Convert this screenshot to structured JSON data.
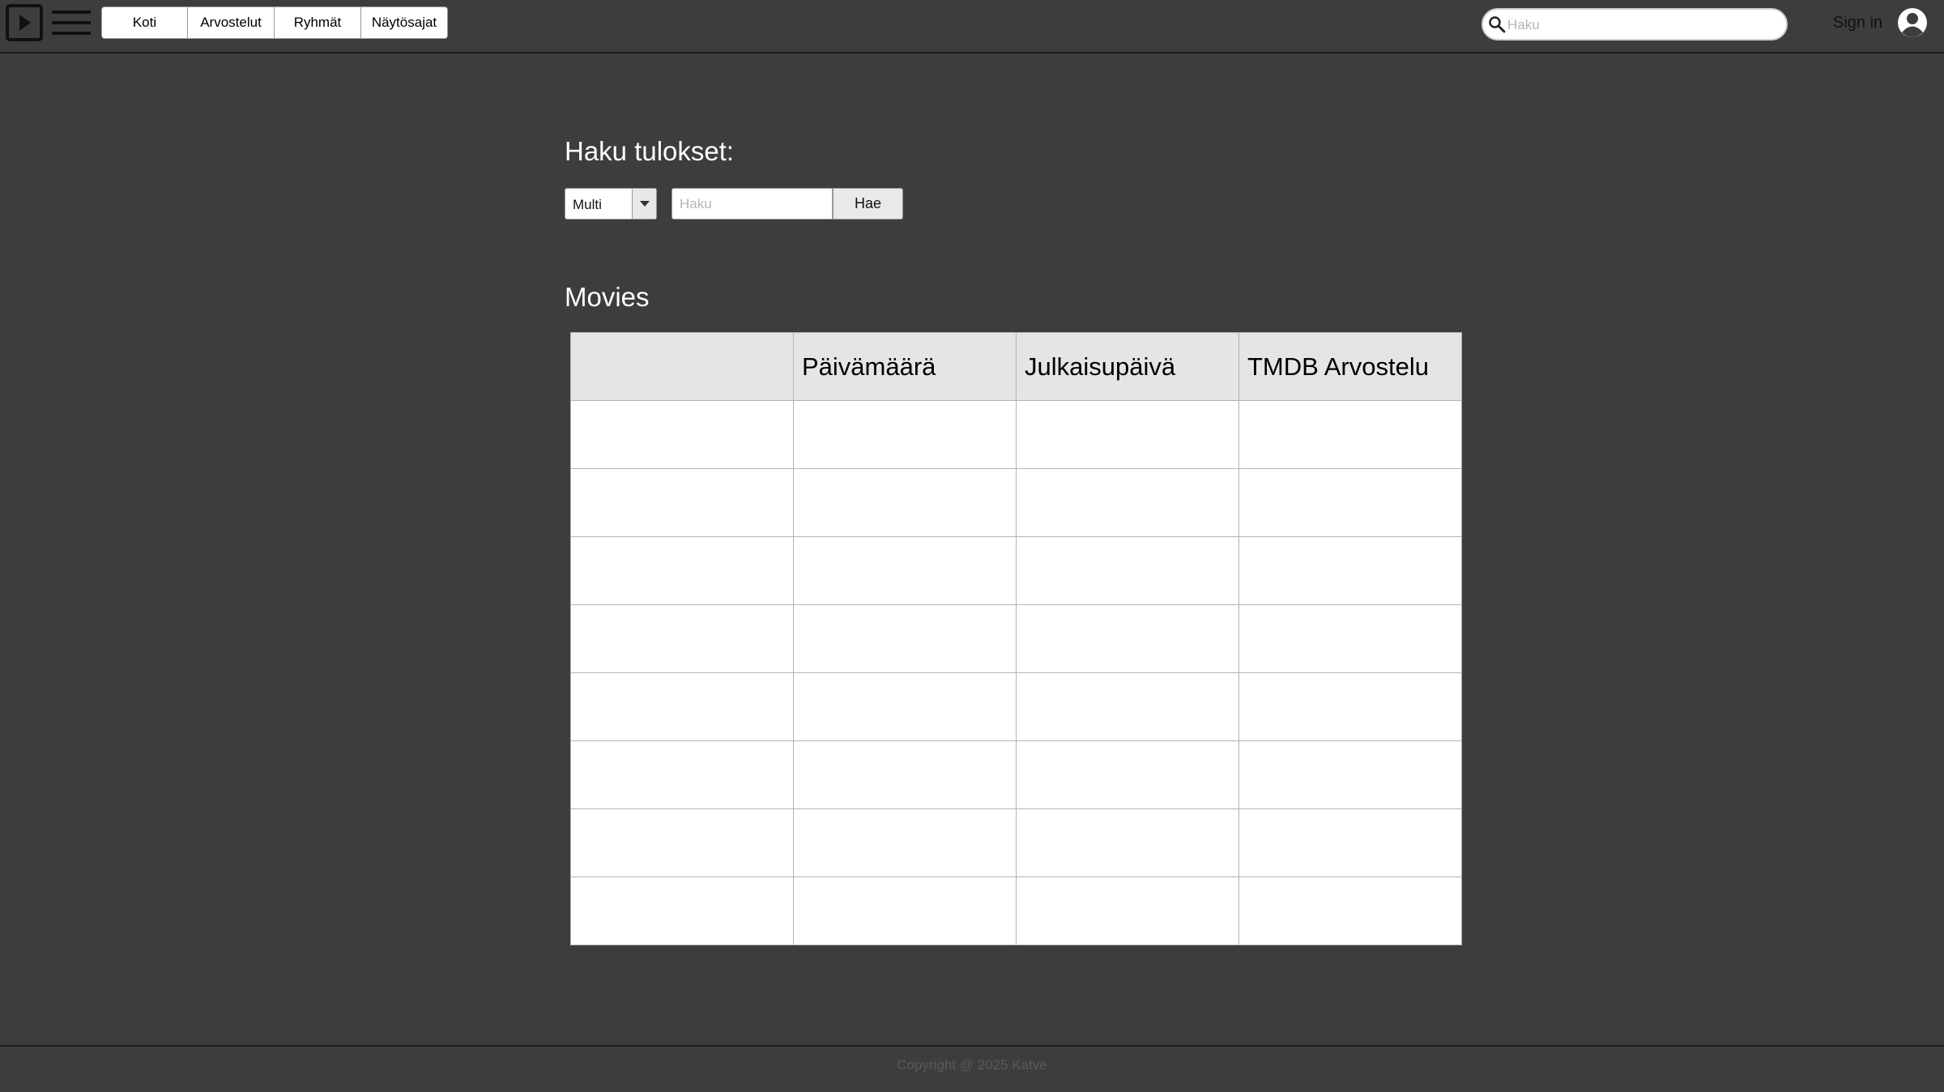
{
  "header": {
    "nav": [
      "Koti",
      "Arvostelut",
      "Ryhmät",
      "Näytösajat"
    ],
    "search_placeholder": "Haku",
    "signin_label": "Sign in"
  },
  "main": {
    "title": "Haku tulokset:",
    "search_type": "Multi",
    "query_placeholder": "Haku",
    "search_button": "Hae",
    "section_title": "Movies",
    "table": {
      "columns": [
        "",
        "Päivämäärä",
        "Julkaisupäivä",
        "TMDB Arvostelu"
      ],
      "rows": [
        [
          "",
          "",
          "",
          ""
        ],
        [
          "",
          "",
          "",
          ""
        ],
        [
          "",
          "",
          "",
          ""
        ],
        [
          "",
          "",
          "",
          ""
        ],
        [
          "",
          "",
          "",
          ""
        ],
        [
          "",
          "",
          "",
          ""
        ],
        [
          "",
          "",
          "",
          ""
        ],
        [
          "",
          "",
          "",
          ""
        ]
      ]
    }
  },
  "footer": {
    "copyright": "Copyright @ 2025 Katve"
  }
}
